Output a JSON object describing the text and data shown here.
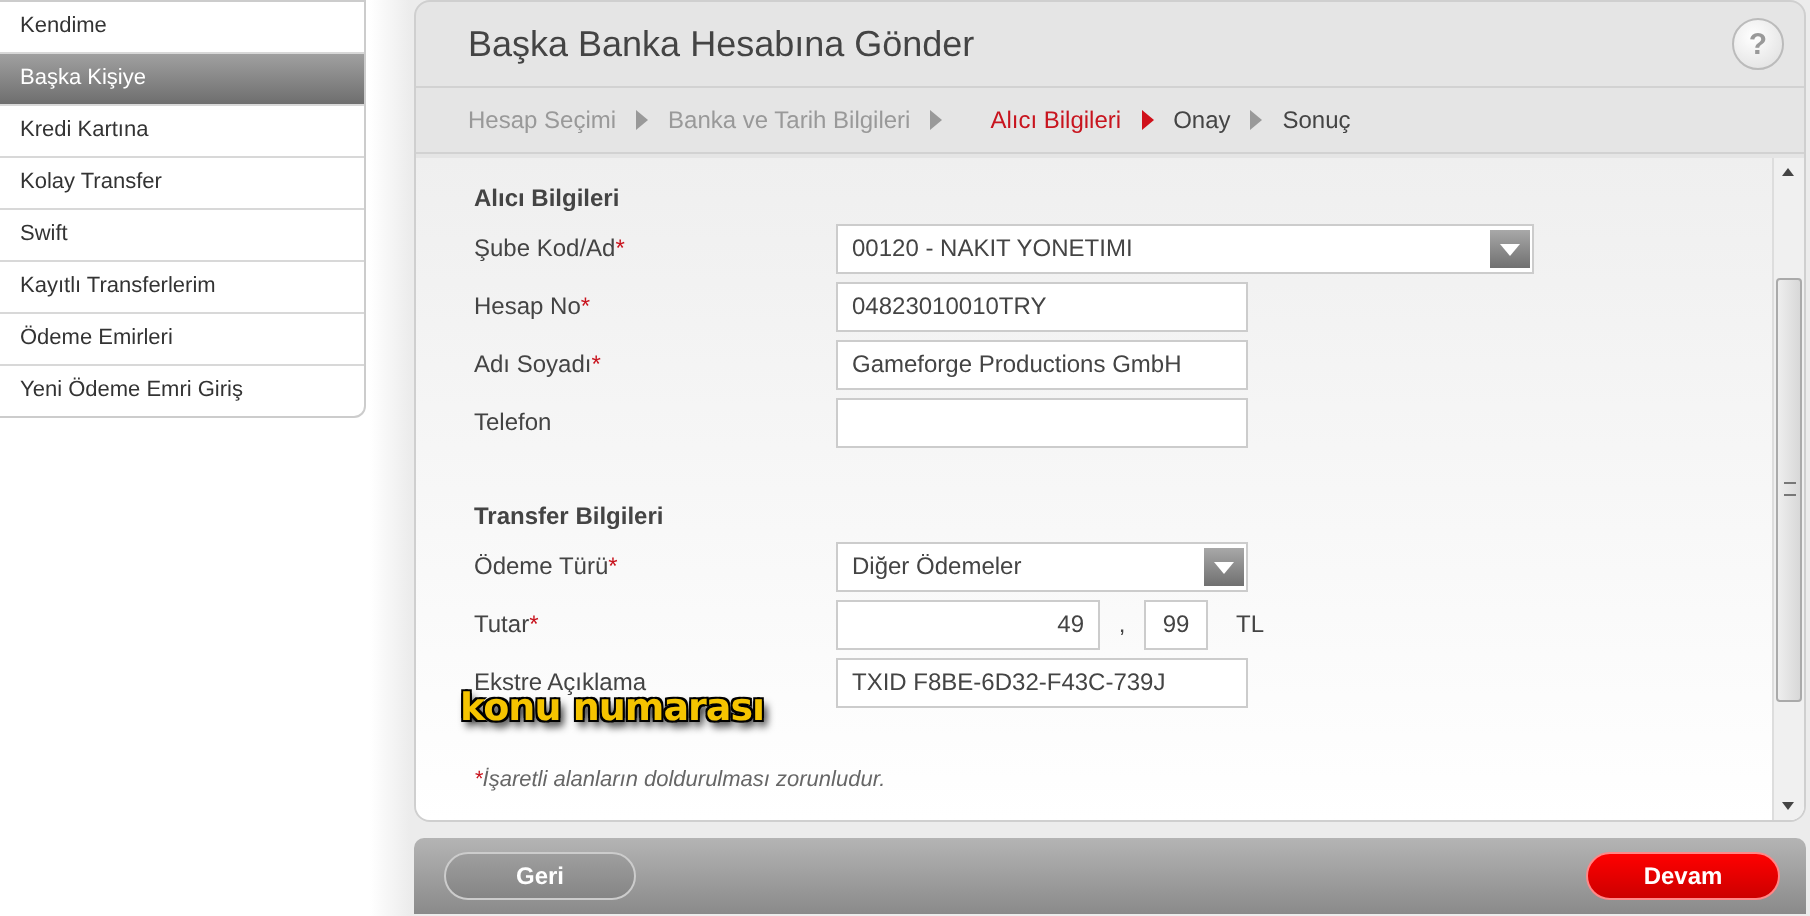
{
  "sidebar": {
    "items": [
      {
        "label": "Kendime",
        "selected": false
      },
      {
        "label": "Başka Kişiye",
        "selected": true
      },
      {
        "label": "Kredi Kartına",
        "selected": false
      },
      {
        "label": "Kolay Transfer",
        "selected": false
      },
      {
        "label": "Swift",
        "selected": false
      },
      {
        "label": "Kayıtlı Transferlerim",
        "selected": false
      },
      {
        "label": "Ödeme Emirleri",
        "selected": false
      },
      {
        "label": "Yeni Ödeme Emri Giriş",
        "selected": false
      }
    ]
  },
  "panel": {
    "title": "Başka Banka Hesabına Gönder",
    "help_label": "?",
    "steps": [
      {
        "label": "Hesap Seçimi",
        "completed": true,
        "selected": false
      },
      {
        "label": "Banka ve Tarih Bilgileri",
        "completed": true,
        "selected": false
      },
      {
        "label": "Alıcı Bilgileri",
        "completed": false,
        "selected": true
      },
      {
        "label": "Onay",
        "completed": false,
        "selected": false
      },
      {
        "label": "Sonuç",
        "completed": false,
        "selected": false
      }
    ],
    "required_mark": "*",
    "sections": [
      {
        "title": "Alıcı Bilgileri",
        "fields": [
          {
            "kind": "select",
            "label": "Şube Kod/Ad",
            "required": true,
            "value": "00120 - NAKIT YONETIMI",
            "wide": true
          },
          {
            "kind": "text",
            "label": "Hesap No",
            "required": true,
            "value": "04823010010TRY"
          },
          {
            "kind": "text",
            "label": "Adı Soyadı",
            "required": true,
            "value": "Gameforge Productions GmbH"
          },
          {
            "kind": "text",
            "label": "Telefon",
            "required": false
          }
        ]
      },
      {
        "title": "Transfer Bilgileri",
        "fields": [
          {
            "kind": "select",
            "label": "Ödeme Türü",
            "required": true,
            "value": "Diğer Ödemeler",
            "wide": false
          },
          {
            "kind": "amount",
            "label": "Tutar",
            "required": true,
            "whole": "49",
            "separator": ",",
            "fraction": "99",
            "currency": "TL"
          },
          {
            "kind": "text",
            "label": "Ekstre Açıklama",
            "required": false,
            "value": "TXID F8BE-6D32-F43C-739J"
          }
        ]
      }
    ],
    "footnote": "İşaretli alanların doldurulması zorunludur.",
    "annotation": "konu numarası"
  },
  "buttons": [
    {
      "label": "Geri",
      "kind": "secondary"
    },
    {
      "label": "Devam",
      "kind": "primary"
    }
  ]
}
